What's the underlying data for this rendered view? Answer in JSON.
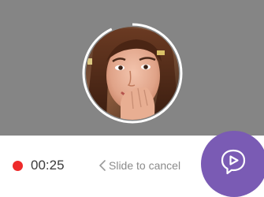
{
  "recording": {
    "timer": "00:25",
    "progress_fraction": 0.93,
    "slide_to_cancel": "Slide to cancel"
  },
  "icons": {
    "record_indicator": "red-dot-icon",
    "chevron": "chevron-left-icon",
    "send": "video-message-send-icon"
  },
  "colors": {
    "preview_background": "#858585",
    "record_dot": "#ee2b2b",
    "send_button": "#7a5bb4",
    "progress_ring": "#ffffff"
  }
}
